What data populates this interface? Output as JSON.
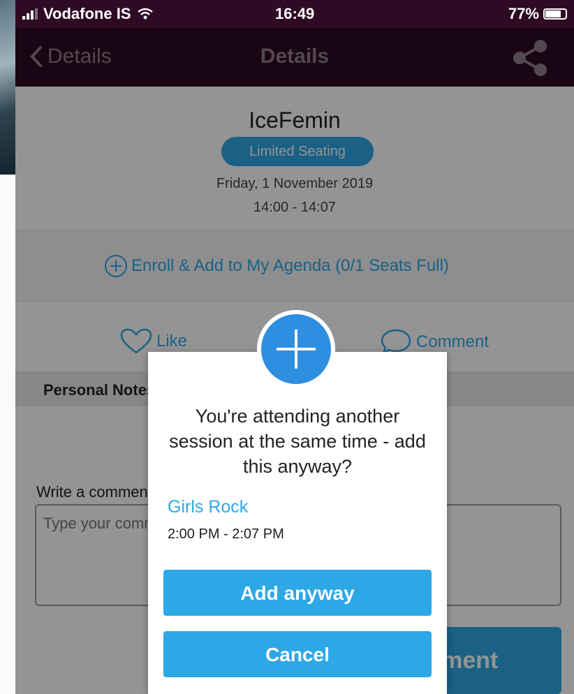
{
  "status_bar": {
    "carrier": "Vodafone IS",
    "time": "16:49",
    "battery": "77%",
    "battery_level": 0.77
  },
  "nav": {
    "back_label": "Details",
    "title": "Details"
  },
  "session": {
    "title": "IceFemin",
    "badge": "Limited Seating",
    "date": "Friday, 1 November 2019",
    "time_range": "14:00 - 14:07"
  },
  "enroll": {
    "label": "Enroll & Add to My Agenda (0/1 Seats Full)"
  },
  "actions": {
    "like": "Like",
    "comment": "Comment"
  },
  "notes": {
    "header": "Personal Notes"
  },
  "comment_form": {
    "label": "Write a comment",
    "placeholder": "Type your comment here",
    "submit": "Comment"
  },
  "dialog": {
    "message": "You're attending another session at the same time - add this anyway?",
    "conflict_session": "Girls Rock",
    "conflict_time": "2:00 PM - 2:07 PM",
    "confirm": "Add anyway",
    "cancel": "Cancel"
  },
  "colors": {
    "accent": "#2ea7e6",
    "nav_bg": "#2e0a24",
    "icon_blue": "#2e8ee0"
  }
}
